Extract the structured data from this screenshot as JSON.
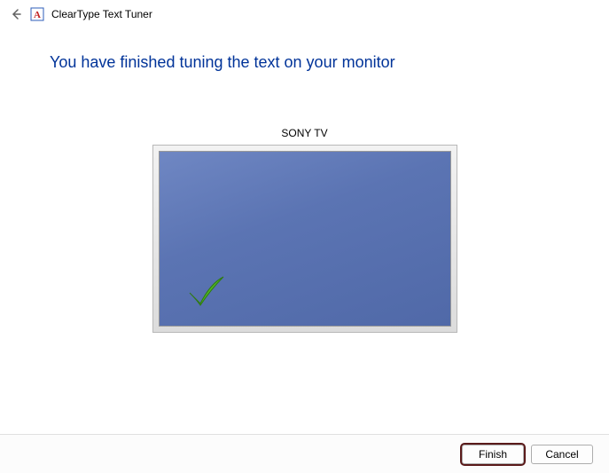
{
  "header": {
    "title": "ClearType Text Tuner"
  },
  "main": {
    "heading": "You have finished tuning the text on your monitor",
    "monitor_label": "SONY TV"
  },
  "footer": {
    "finish_label": "Finish",
    "cancel_label": "Cancel"
  },
  "icons": {
    "back": "back-arrow-icon",
    "app": "cleartype-app-icon",
    "check": "checkmark-icon"
  },
  "colors": {
    "heading": "#003399",
    "screen_top": "#6f87c3",
    "screen_bottom": "#5069a8",
    "check": "#3fa31f",
    "highlight": "#5a1a1a"
  }
}
